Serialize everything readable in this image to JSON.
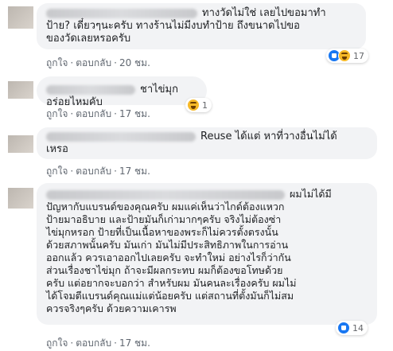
{
  "actions": {
    "like": "ถูกใจ",
    "reply": "ตอบกลับ",
    "sep": "·"
  },
  "comments": [
    {
      "text": "ทางวัดไม่ใช่ เลยไปขอมาทำ\nป้าย? เดี๋ยวๆนะครับ ทางร้านไม่มีงบทำป้าย ถึงขนาดไปขอ\nของวัดเลยหรอครับ",
      "time": "20 ชม.",
      "reaction_count": "17",
      "reactions": [
        "like-icon",
        "haha-icon"
      ]
    },
    {
      "text": "ชาไข่มุกอร่อยไหมคับ",
      "time": "17 ชม.",
      "reaction_count": "1",
      "reactions": [
        "haha-icon"
      ]
    },
    {
      "text": "Reuse ได้แต่ หาที่วางอื่นไม่ได้\nเหรอ",
      "time": "17 ชม."
    },
    {
      "text": "ผมไม่ได้มี\nปัญหากับแบรนด์ของคุณครับ ผมแค่เห็นว่าไกด์ต้องแหวก\nป้ายมาอธิบาย และป้ายมันก็เก่ามากๆครับ จริงไม่ต้องซ่า\nไข่มุกหรอก ป้ายที่เป็นเนื้อหาของพระก็ไม่ควรตั้งตรงนั้น\nด้วยสภาพนั้นครับ มันเก่า มันไม่มีประสิทธิภาพในการอ่าน\nออกแล้ว ควรเอาออกไปเลยครับ จะทำใหม่ อย่างไรก็ว่ากัน\nส่วนเรื่องชาไข่มุก ถ้าจะมีผลกระทบ ผมก็ต้องขอโทษด้วย\nครับ แต่อยากจะบอกว่า สำหรับผม มันคนละเรื่องครับ ผมไม่\nได้โจมตีแบรนด์คุณแม่แต่น้อยครับ แต่สถานที่ตั้งมันก็ไม่สม\nควรจริงๆครับ ด้วยความเคารพ",
      "time": "17 ชม.",
      "reaction_count": "14",
      "reactions": [
        "like-icon"
      ]
    }
  ]
}
